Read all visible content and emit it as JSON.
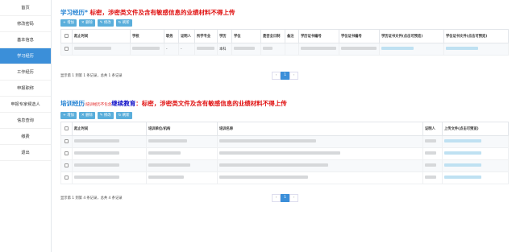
{
  "sidebar": {
    "items": [
      {
        "label": "首页"
      },
      {
        "label": "修改密码"
      },
      {
        "label": "基本信息"
      },
      {
        "label": "学习经历"
      },
      {
        "label": "工作经历"
      },
      {
        "label": "申报职称"
      },
      {
        "label": "申报专家候选人"
      },
      {
        "label": "信息查询"
      },
      {
        "label": "缴费"
      },
      {
        "label": "退出"
      }
    ],
    "active_index": 3
  },
  "study": {
    "title": "学习经历*",
    "warning": "标密，涉密类文件及含有敏感信息的业绩材料不得上传",
    "buttons": {
      "add": "增加",
      "delete": "删除",
      "edit": "修改",
      "refresh": "刷新"
    },
    "columns": [
      "起止时间",
      "学校",
      "职务",
      "证明人",
      "所学专业",
      "学历",
      "学位",
      "是否全日制",
      "备注",
      "学历证书编号",
      "学位证书编号",
      "学历证书文件(点击可预览)",
      "学位证书文件(点击可预览)"
    ],
    "rows": [
      {
        "duty": "-",
        "witness": "-",
        "education": "本科"
      }
    ],
    "page_info": "显示第 1 到第 1 条记录，总共 1 条记录",
    "pager": {
      "prev": "‹",
      "current": "1",
      "next": "›"
    }
  },
  "training": {
    "title": "培训经历",
    "note": "(培训经历不包含",
    "continuing": "继续教育",
    "warning": "：标密，涉密类文件及含有敏感信息的业绩材料不得上传",
    "buttons": {
      "add": "增加",
      "delete": "删除",
      "edit": "修改",
      "refresh": "刷新"
    },
    "columns": [
      "起止时间",
      "培训单位/机构",
      "培训名称",
      "证明人",
      "上传文件(点击可预览)"
    ],
    "row_count": 4,
    "page_info": "显示第 1 到第 4 条记录，总共 4 条记录",
    "pager": {
      "prev": "‹",
      "current": "1",
      "next": "›"
    }
  },
  "colors": {
    "accent": "#3b8fd9",
    "title_blue": "#1e7fd2",
    "warning_red": "#e01010",
    "navy": "#1010c8",
    "button": "#5aaedb"
  }
}
